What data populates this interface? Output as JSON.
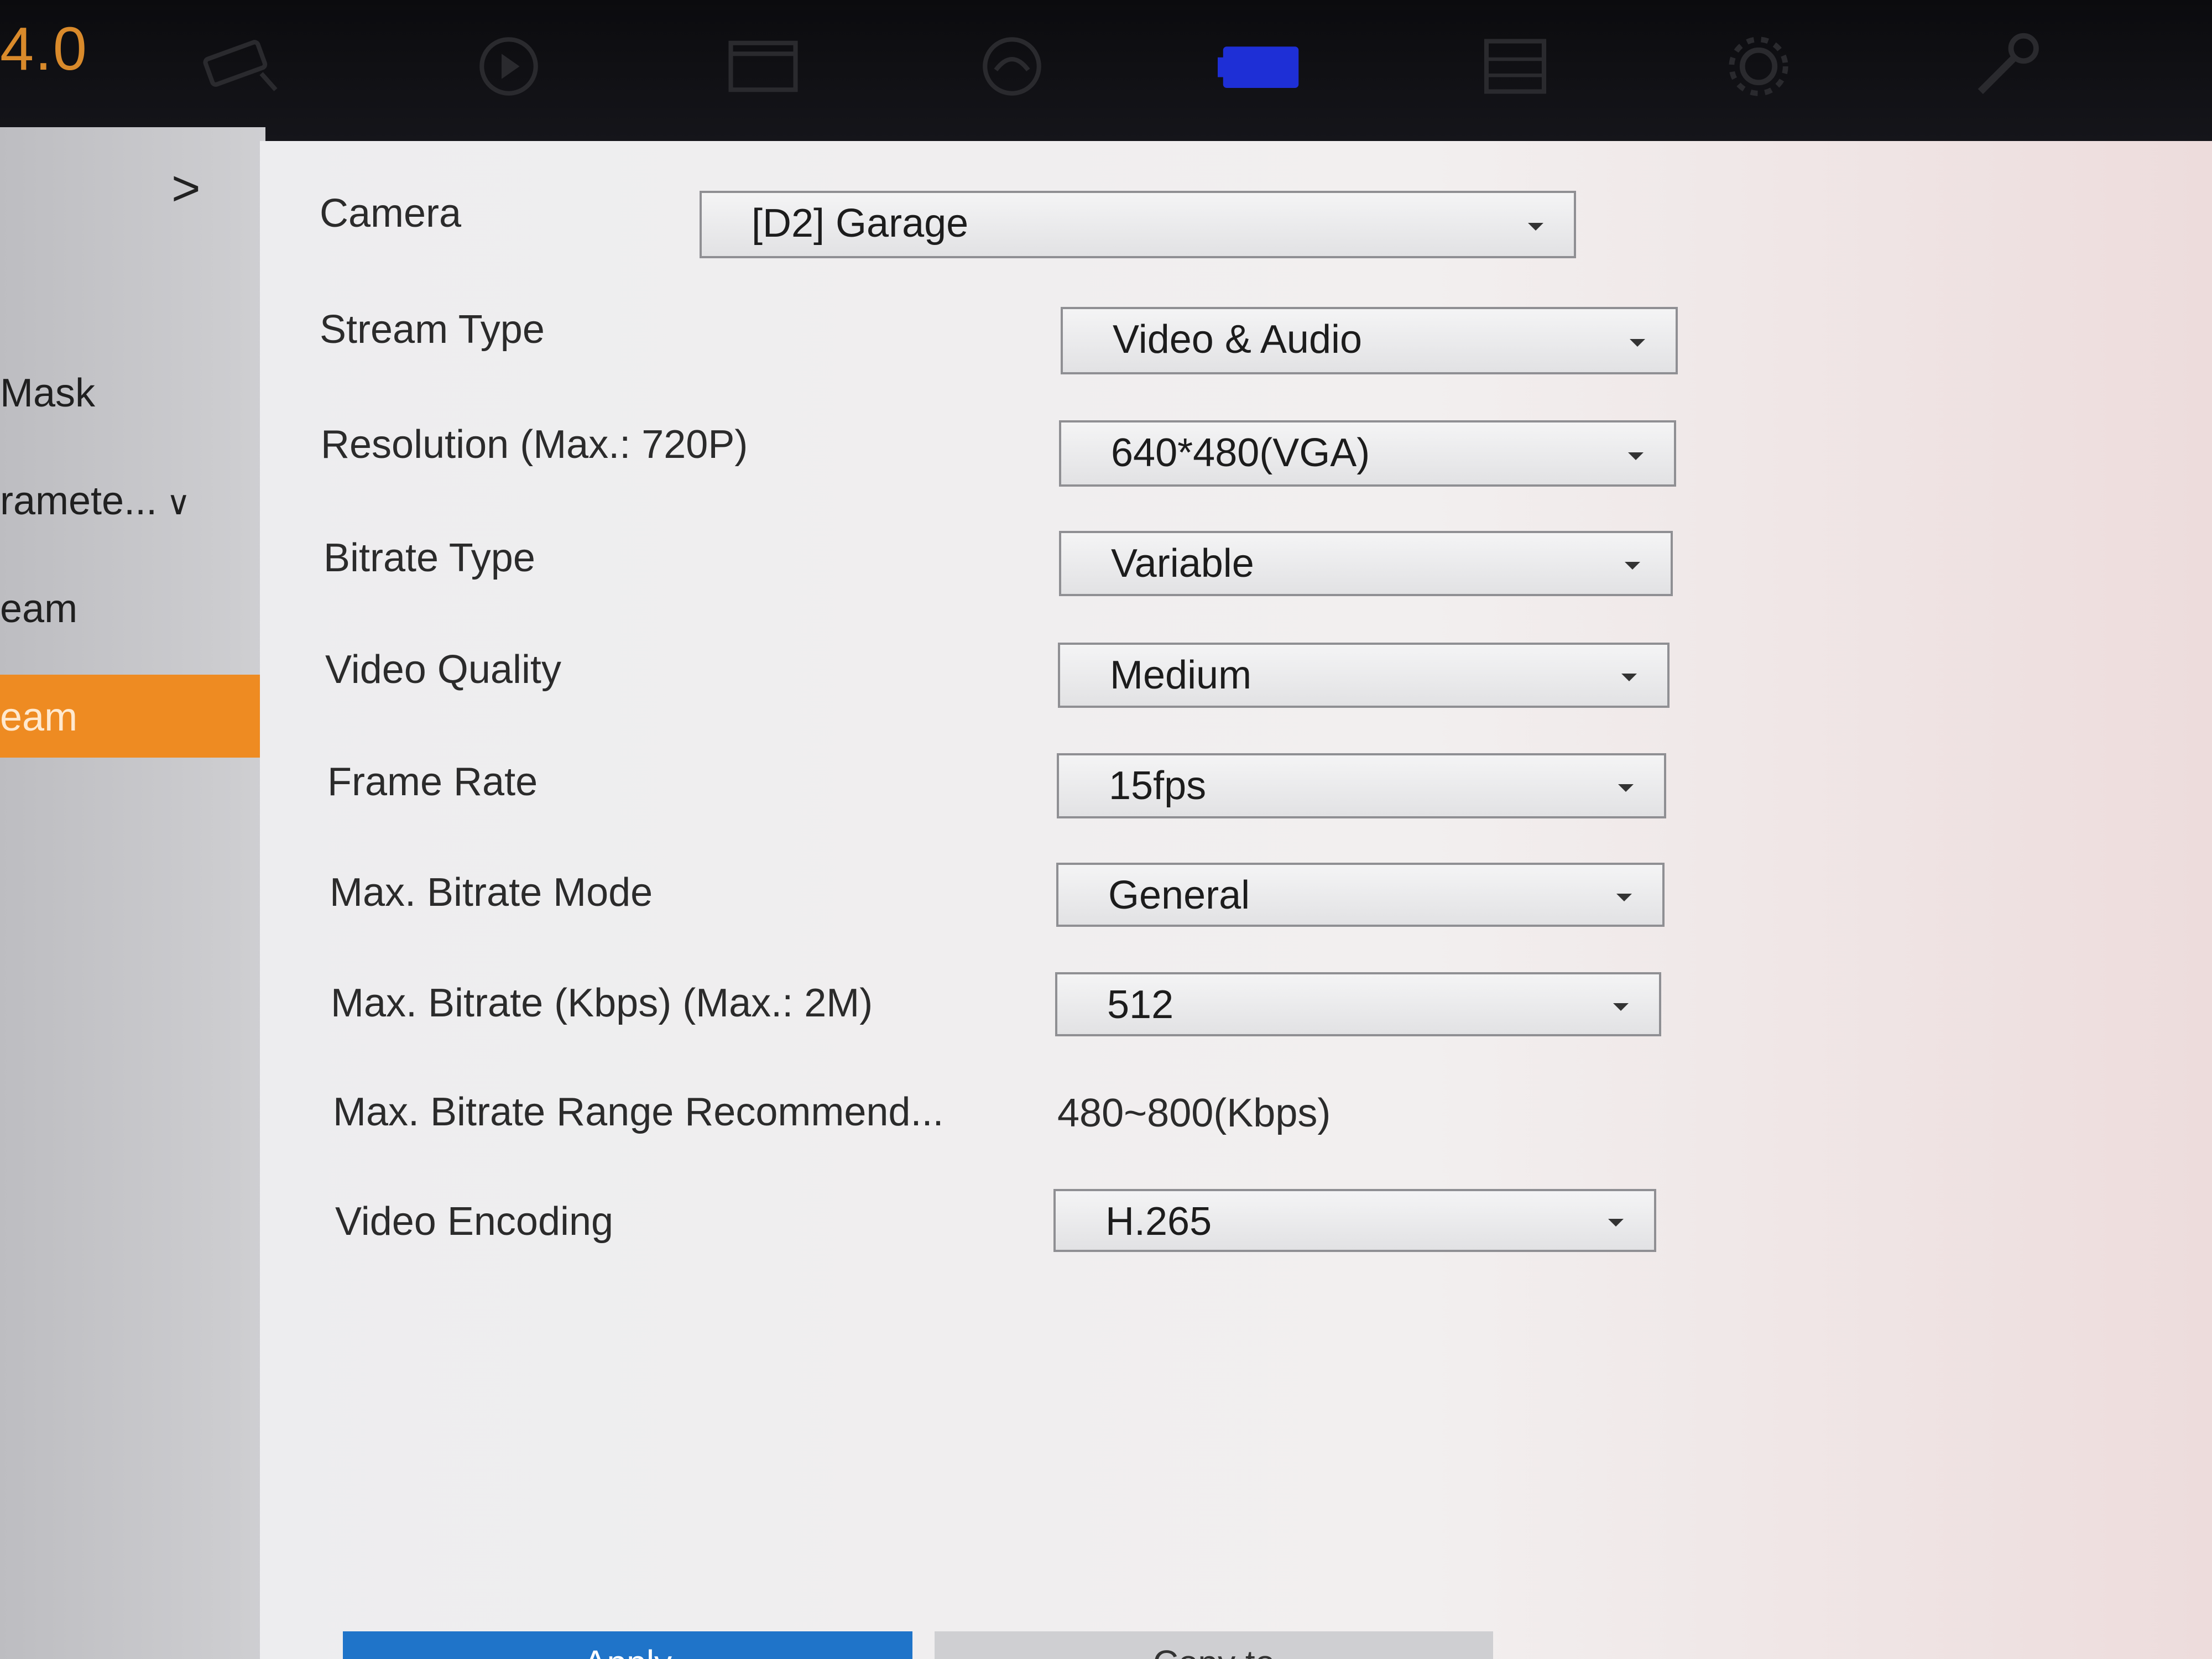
{
  "header": {
    "version": "4.0",
    "icons": [
      "camera-icon",
      "playback-icon",
      "file-icon",
      "record-icon",
      "video-settings-icon",
      "storage-icon",
      "gear-icon",
      "wrench-icon"
    ]
  },
  "sidebar": {
    "items": [
      {
        "label": "Mask"
      },
      {
        "label": "ramete..."
      },
      {
        "label": "eam"
      },
      {
        "label": "eam"
      }
    ]
  },
  "form": {
    "rows": [
      {
        "label": "Camera",
        "value": "[D2] Garage"
      },
      {
        "label": "Stream Type",
        "value": "Video & Audio"
      },
      {
        "label": "Resolution (Max.: 720P)",
        "value": "640*480(VGA)"
      },
      {
        "label": "Bitrate Type",
        "value": "Variable"
      },
      {
        "label": "Video Quality",
        "value": "Medium"
      },
      {
        "label": "Frame Rate",
        "value": "15fps"
      },
      {
        "label": "Max. Bitrate Mode",
        "value": "General"
      },
      {
        "label": "Max. Bitrate (Kbps) (Max.: 2M)",
        "value": "512"
      },
      {
        "label": "Max. Bitrate Range Recommend...",
        "value": "480~800(Kbps)"
      },
      {
        "label": "Video Encoding",
        "value": "H.265"
      }
    ]
  },
  "buttons": {
    "apply": "Apply",
    "copy": "Copy to"
  },
  "colors": {
    "accent": "#ee8b22",
    "primary_button": "#1f74c9",
    "active_top_icon": "#1e2fd6"
  }
}
